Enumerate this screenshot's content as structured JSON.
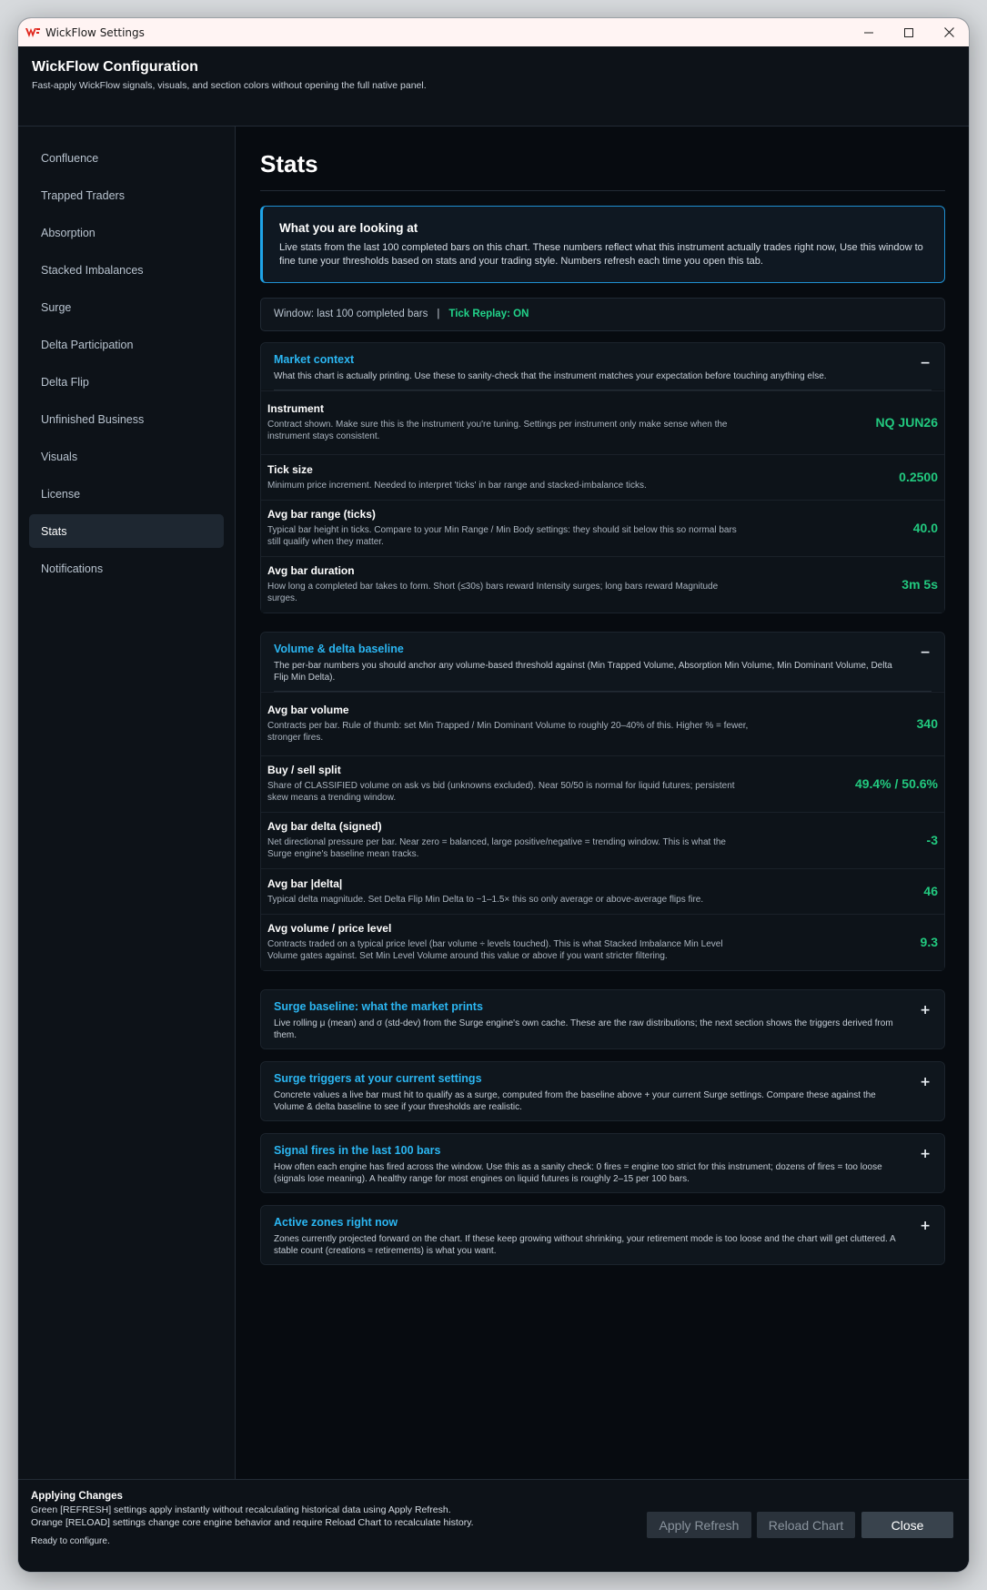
{
  "window": {
    "title": "WickFlow Settings",
    "brand_color": "#e0261c"
  },
  "header": {
    "title": "WickFlow Configuration",
    "subtitle": "Fast-apply WickFlow signals, visuals, and section colors without opening the full native panel."
  },
  "sidebar": {
    "items": [
      {
        "label": "Confluence",
        "active": false
      },
      {
        "label": "Trapped Traders",
        "active": false
      },
      {
        "label": "Absorption",
        "active": false
      },
      {
        "label": "Stacked Imbalances",
        "active": false
      },
      {
        "label": "Surge",
        "active": false
      },
      {
        "label": "Delta Participation",
        "active": false
      },
      {
        "label": "Delta Flip",
        "active": false
      },
      {
        "label": "Unfinished Business",
        "active": false
      },
      {
        "label": "Visuals",
        "active": false
      },
      {
        "label": "License",
        "active": false
      },
      {
        "label": "Stats",
        "active": true
      },
      {
        "label": "Notifications",
        "active": false
      }
    ]
  },
  "main": {
    "title": "Stats",
    "info": {
      "title": "What you are looking at",
      "body": "Live stats from the last 100 completed bars on this chart. These numbers reflect what this instrument actually trades right now, Use this window to fine tune your thresholds based on stats and your trading style. Numbers refresh each time you open this tab."
    },
    "window_bar": {
      "text": "Window: last 100 completed bars",
      "separator": "|",
      "tick_replay": "Tick Replay: ON"
    },
    "sections": [
      {
        "title": "Market context",
        "desc": "What this chart is actually printing. Use these to sanity-check that the instrument matches your expectation before touching anything else.",
        "toggle": "−",
        "expanded": true,
        "rows": [
          {
            "label": "Instrument",
            "desc": "Contract shown. Make sure this is the instrument you're tuning. Settings per instrument only make sense when the instrument stays consistent.",
            "value": "NQ JUN26"
          },
          {
            "label": "Tick size",
            "desc": "Minimum price increment. Needed to interpret 'ticks' in bar range and stacked-imbalance ticks.",
            "value": "0.2500"
          },
          {
            "label": "Avg bar range (ticks)",
            "desc": "Typical bar height in ticks. Compare to your Min Range / Min Body settings: they should sit below this so normal bars still qualify when they matter.",
            "value": "40.0"
          },
          {
            "label": "Avg bar duration",
            "desc": "How long a completed bar takes to form. Short (≤30s) bars reward Intensity surges; long bars reward Magnitude surges.",
            "value": "3m 5s"
          }
        ]
      },
      {
        "title": "Volume & delta baseline",
        "desc": "The per-bar numbers you should anchor any volume-based threshold against (Min Trapped Volume, Absorption Min Volume, Min Dominant Volume, Delta Flip Min Delta).",
        "toggle": "−",
        "expanded": true,
        "rows": [
          {
            "label": "Avg bar volume",
            "desc": "Contracts per bar. Rule of thumb: set Min Trapped / Min Dominant Volume to roughly 20–40% of this. Higher % = fewer, stronger fires.",
            "value": "340"
          },
          {
            "label": "Buy / sell split",
            "desc": "Share of CLASSIFIED volume on ask vs bid (unknowns excluded). Near 50/50 is normal for liquid futures; persistent skew means a trending window.",
            "value": "49.4% / 50.6%"
          },
          {
            "label": "Avg bar delta (signed)",
            "desc": "Net directional pressure per bar. Near zero = balanced, large positive/negative = trending window. This is what the Surge engine's baseline mean tracks.",
            "value": "-3"
          },
          {
            "label": "Avg bar |delta|",
            "desc": "Typical delta magnitude. Set Delta Flip Min Delta to ~1–1.5× this so only average or above-average flips fire.",
            "value": "46"
          },
          {
            "label": "Avg volume / price level",
            "desc": "Contracts traded on a typical price level (bar volume ÷ levels touched). This is what Stacked Imbalance Min Level Volume gates against. Set Min Level Volume around this value or above if you want stricter filtering.",
            "value": "9.3"
          }
        ]
      },
      {
        "title": "Surge baseline: what the market prints",
        "desc": "Live rolling μ (mean) and σ (std-dev) from the Surge engine's own cache. These are the raw distributions; the next section shows the triggers derived from them.",
        "toggle": "+",
        "expanded": false,
        "rows": []
      },
      {
        "title": "Surge triggers at your current settings",
        "desc": "Concrete values a live bar must hit to qualify as a surge, computed from the baseline above + your current Surge settings. Compare these against the Volume & delta baseline to see if your thresholds are realistic.",
        "toggle": "+",
        "expanded": false,
        "rows": []
      },
      {
        "title": "Signal fires in the last 100 bars",
        "desc": "How often each engine has fired across the window. Use this as a sanity check: 0 fires = engine too strict for this instrument; dozens of fires = too loose (signals lose meaning). A healthy range for most engines on liquid futures is roughly 2–15 per 100 bars.",
        "toggle": "+",
        "expanded": false,
        "rows": []
      },
      {
        "title": "Active zones right now",
        "desc": "Zones currently projected forward on the chart. If these keep growing without shrinking, your retirement mode is too loose and the chart will get cluttered. A stable count (creations ≈ retirements) is what you want.",
        "toggle": "+",
        "expanded": false,
        "rows": []
      }
    ]
  },
  "footer": {
    "title": "Applying Changes",
    "line1": "Green [REFRESH] settings apply instantly without recalculating historical data using Apply Refresh.",
    "line2": "Orange [RELOAD] settings change core engine behavior and require Reload Chart to recalculate history.",
    "status": "Ready to configure.",
    "buttons": {
      "apply_refresh": "Apply Refresh",
      "reload_chart": "Reload Chart",
      "close": "Close"
    }
  },
  "colors": {
    "accent_blue": "#2bb6f2",
    "value_green": "#22c97f",
    "tick_replay_green": "#22d38a"
  }
}
